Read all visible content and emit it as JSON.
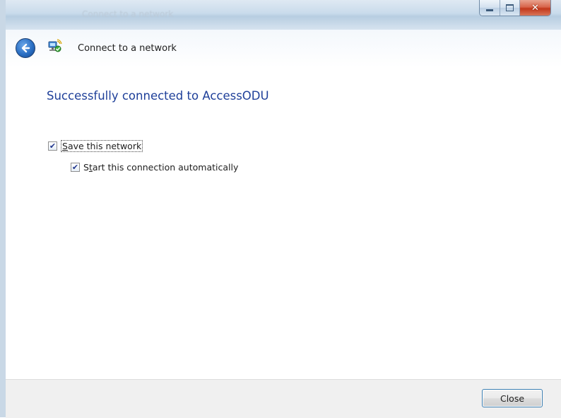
{
  "window": {
    "title": "Connect to a network"
  },
  "header": {
    "title": "Connect to a network"
  },
  "main": {
    "heading": "Successfully connected to AccessODU",
    "save_network": {
      "label_first": "S",
      "label_rest": "ave this network",
      "checked": true
    },
    "auto_connect": {
      "label_first": "S",
      "label_underlined": "t",
      "label_rest": "art this connection automatically",
      "checked": true
    }
  },
  "footer": {
    "close_label": "Close"
  },
  "colors": {
    "heading": "#1e3f99",
    "accent": "#2a6fc4",
    "close_button": "#c2381b"
  }
}
